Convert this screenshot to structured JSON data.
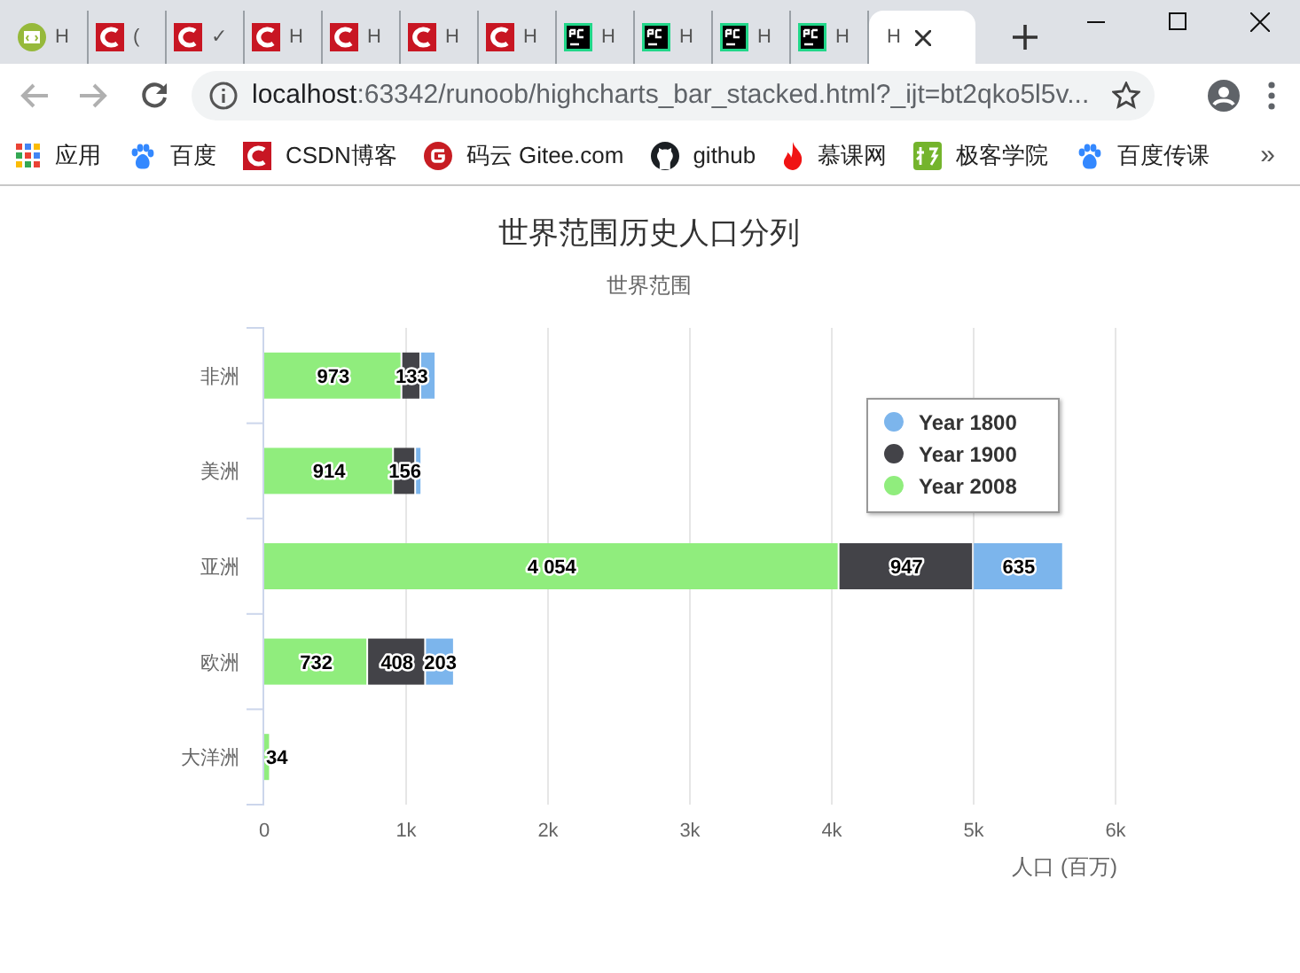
{
  "browser": {
    "tabs": [
      {
        "kind": "runoob",
        "title": "H",
        "selected": false
      },
      {
        "kind": "csdn",
        "title": "(",
        "selected": false
      },
      {
        "kind": "csdn",
        "title": "✓",
        "selected": false
      },
      {
        "kind": "csdn",
        "title": "H",
        "selected": false
      },
      {
        "kind": "csdn",
        "title": "H",
        "selected": false
      },
      {
        "kind": "csdn",
        "title": "H",
        "selected": false
      },
      {
        "kind": "csdn",
        "title": "H",
        "selected": false
      },
      {
        "kind": "pycharm",
        "title": "H",
        "selected": false
      },
      {
        "kind": "pycharm",
        "title": "H",
        "selected": false
      },
      {
        "kind": "pycharm",
        "title": "H",
        "selected": false
      },
      {
        "kind": "pycharm",
        "title": "H",
        "selected": false
      },
      {
        "kind": "plain",
        "title": "H",
        "selected": true
      }
    ],
    "url_host": "localhost",
    "url_rest": ":63342/runoob/highcharts_bar_stacked.html?_ijt=bt2qko5l5v...",
    "bookmarks": [
      {
        "kind": "apps",
        "label": "应用"
      },
      {
        "kind": "paw",
        "label": "百度"
      },
      {
        "kind": "csdn",
        "label": "CSDN博客"
      },
      {
        "kind": "gitee",
        "label": "码云 Gitee.com"
      },
      {
        "kind": "github",
        "label": "github"
      },
      {
        "kind": "flame",
        "label": "慕课网"
      },
      {
        "kind": "jike",
        "label": "极客学院"
      },
      {
        "kind": "paw",
        "label": "百度传课"
      }
    ],
    "bookmarks_more": "»"
  },
  "chart": {
    "chart_data": {
      "type": "bar",
      "orientation": "horizontal",
      "stacked": true,
      "title": "世界范围历史人口分列",
      "subtitle": "世界范围",
      "xlabel": "人口 (百万)",
      "categories": [
        "非洲",
        "美洲",
        "亚洲",
        "欧洲",
        "大洋洲"
      ],
      "xlim": [
        0,
        6000
      ],
      "xticks": [
        {
          "value": 0,
          "label": "0"
        },
        {
          "value": 1000,
          "label": "1k"
        },
        {
          "value": 2000,
          "label": "2k"
        },
        {
          "value": 3000,
          "label": "3k"
        },
        {
          "value": 4000,
          "label": "4k"
        },
        {
          "value": 5000,
          "label": "5k"
        },
        {
          "value": 6000,
          "label": "6k"
        }
      ],
      "legend": true,
      "grid": true,
      "data_labels": "value_labels",
      "series": [
        {
          "name": "Year 1800",
          "color": "#7cb5ec",
          "values": [
            107,
            31,
            635,
            203,
            null
          ],
          "value_labels": [
            null,
            null,
            "635",
            "203",
            null
          ]
        },
        {
          "name": "Year 1900",
          "color": "#434348",
          "values": [
            133,
            156,
            947,
            408,
            null
          ],
          "value_labels": [
            "133",
            "156",
            "947",
            "408",
            null
          ]
        },
        {
          "name": "Year 2008",
          "color": "#90ed7d",
          "values": [
            973,
            914,
            4054,
            732,
            34
          ],
          "value_labels": [
            "973",
            "914",
            "4 054",
            "732",
            "34"
          ]
        }
      ]
    }
  }
}
